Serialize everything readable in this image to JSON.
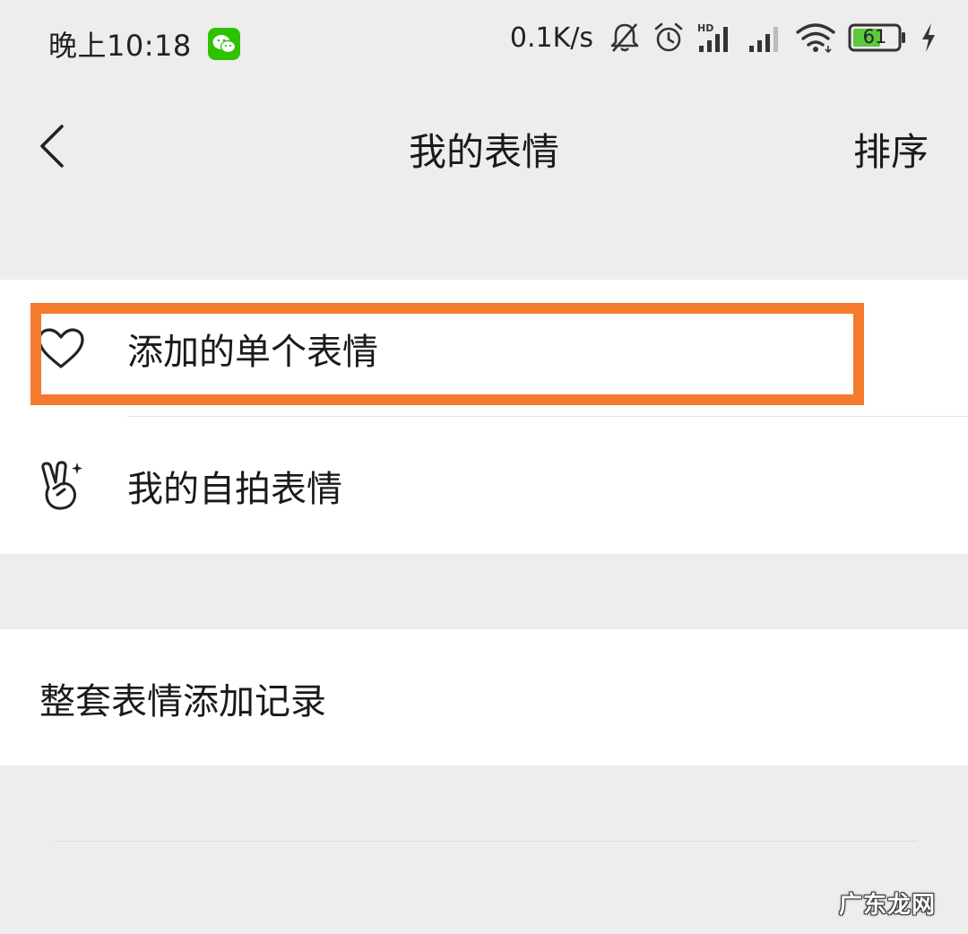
{
  "status_bar": {
    "time": "晚上10:18",
    "app_icon": "wechat-icon",
    "net_speed": "0.1K/s",
    "icons": [
      "bell-off-icon",
      "alarm-icon",
      "hd-signal-icon",
      "signal-icon",
      "wifi-icon",
      "battery-icon",
      "charging-icon"
    ],
    "hd_label": "HD",
    "battery_level": "61",
    "battery_color": "#5cc83c"
  },
  "nav": {
    "back_icon": "chevron-left-icon",
    "title": "我的表情",
    "sort_label": "排序"
  },
  "groups": [
    {
      "items": [
        {
          "icon": "heart-icon",
          "label": "添加的单个表情",
          "highlighted": true
        },
        {
          "icon": "victory-hand-icon",
          "label": "我的自拍表情"
        }
      ]
    },
    {
      "items": [
        {
          "label": "整套表情添加记录"
        }
      ]
    }
  ],
  "highlight_color": "#f47a2e",
  "watermark": "广东龙网"
}
